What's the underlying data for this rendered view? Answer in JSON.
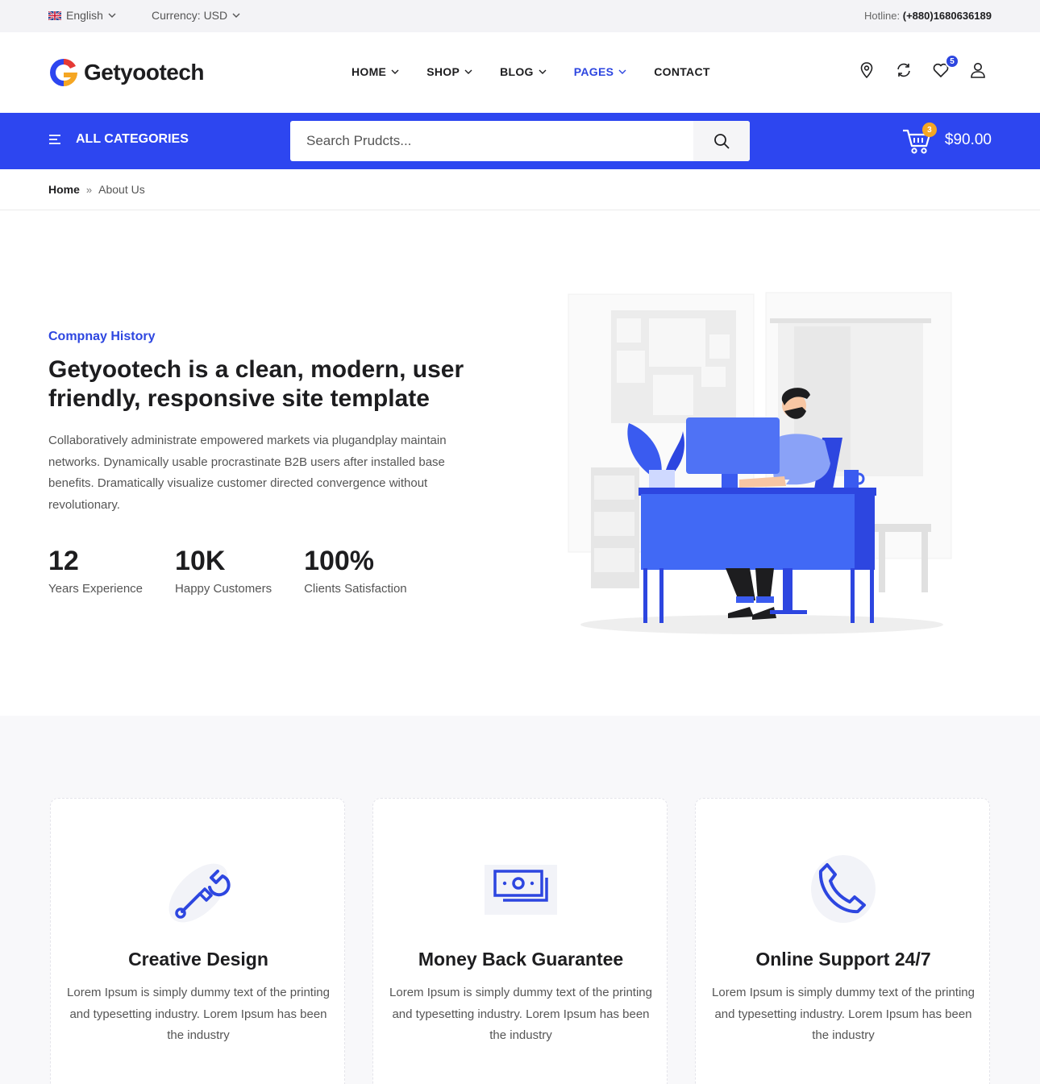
{
  "topbar": {
    "language": "English",
    "currency": "Currency: USD",
    "hotline_label": "Hotline:",
    "hotline_number": "(+880)1680636189"
  },
  "header": {
    "logo_text": "Getyootech",
    "nav": [
      {
        "label": "HOME",
        "has_dropdown": true
      },
      {
        "label": "SHOP",
        "has_dropdown": true
      },
      {
        "label": "BLOG",
        "has_dropdown": true
      },
      {
        "label": "PAGES",
        "has_dropdown": true,
        "active": true
      },
      {
        "label": "CONTACT",
        "has_dropdown": false
      }
    ],
    "icons": [
      "location-icon",
      "compare-icon",
      "wishlist-icon",
      "user-icon"
    ],
    "wishlist_count": "5"
  },
  "catbar": {
    "categories_label": "ALL CATEGORIES",
    "search_placeholder": "Search Prudcts...",
    "cart_count": "3",
    "cart_total": "$90.00"
  },
  "breadcrumb": {
    "home": "Home",
    "separator": "»",
    "current": "About Us"
  },
  "about": {
    "kicker": "Compnay History",
    "title": "Getyootech is a clean, modern, user friendly, responsive site template",
    "text": "Collaboratively administrate empowered markets via plugandplay maintain networks. Dynamically usable procrastinate B2B users after installed base benefits. Dramatically visualize customer directed convergence without revolutionary.",
    "stats": [
      {
        "value": "12",
        "label": "Years Experience"
      },
      {
        "value": "10K",
        "label": "Happy Customers"
      },
      {
        "value": "100%",
        "label": "Clients Satisfaction"
      }
    ]
  },
  "features": [
    {
      "icon": "design-tools-icon",
      "title": "Creative Design",
      "text": "Lorem Ipsum is simply dummy text of the printing and typesetting industry. Lorem Ipsum has been the industry"
    },
    {
      "icon": "money-icon",
      "title": "Money Back Guarantee",
      "text": "Lorem Ipsum is simply dummy text of the printing and typesetting industry. Lorem Ipsum has been the industry"
    },
    {
      "icon": "phone-icon",
      "title": "Online Support 24/7",
      "text": "Lorem Ipsum is simply dummy text of the printing and typesetting industry. Lorem Ipsum has been the industry"
    }
  ],
  "colors": {
    "primary": "#2d46f0",
    "accent": "#f5a623",
    "text": "#1d1d1f"
  }
}
